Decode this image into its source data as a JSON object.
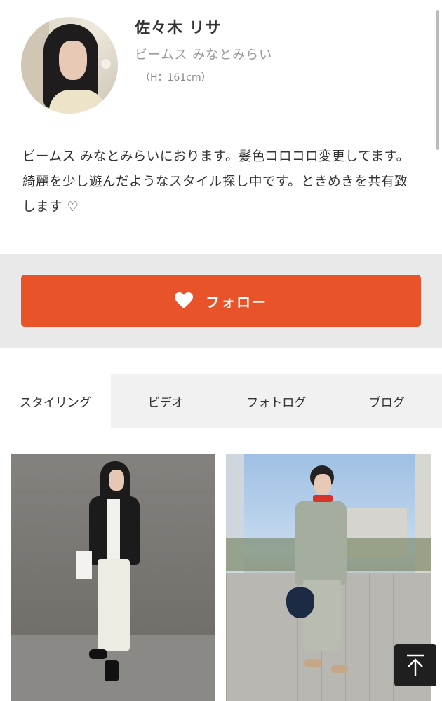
{
  "profile": {
    "name": "佐々木 リサ",
    "shop": "ビームス みなとみらい",
    "height": "（H：161cm）",
    "bio": "ビームス みなとみらいにおります。髪色コロコロ変更してます。綺麗を少し遊んだようなスタイル探し中です。ときめきを共有致します ♡"
  },
  "follow": {
    "label": "フォロー",
    "icon": "heart-icon",
    "color": "#e8532a"
  },
  "tabs": [
    {
      "label": "スタイリング",
      "active": true
    },
    {
      "label": "ビデオ",
      "active": false
    },
    {
      "label": "フォトログ",
      "active": false
    },
    {
      "label": "ブログ",
      "active": false
    }
  ],
  "back_to_top": {
    "icon": "arrow-up-icon"
  }
}
